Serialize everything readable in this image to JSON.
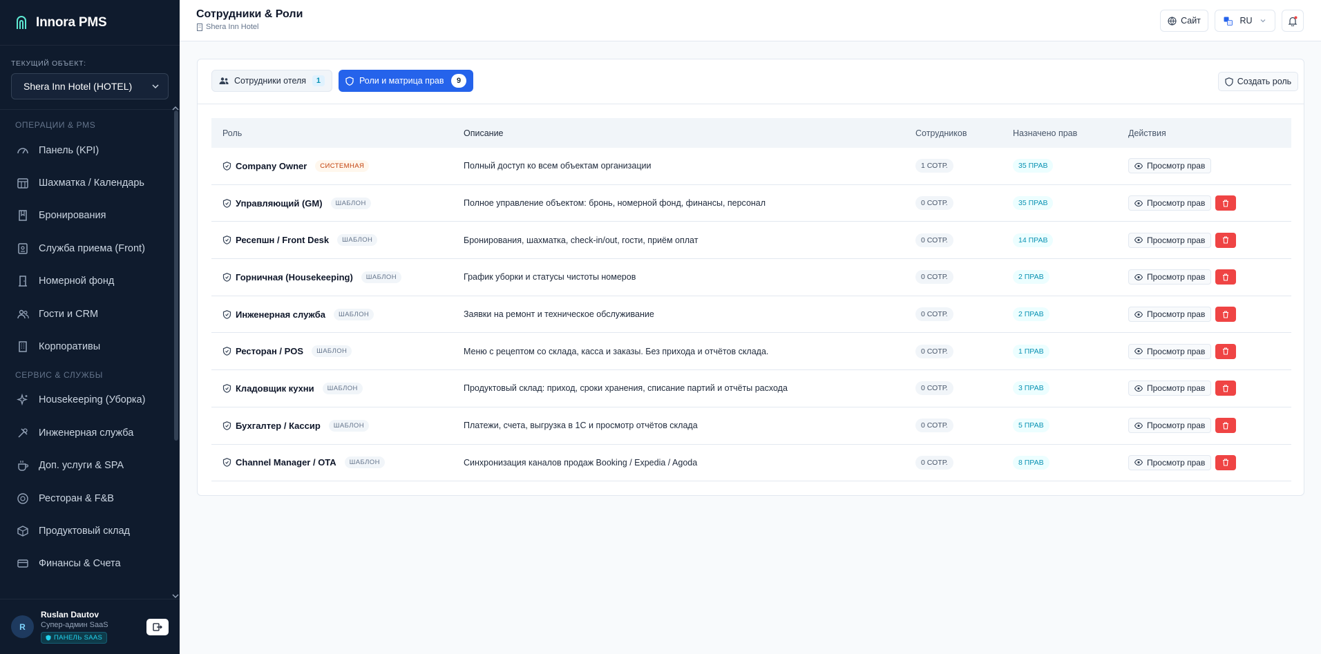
{
  "sidebar": {
    "brand": "Innora PMS",
    "object_label": "ТЕКУЩИЙ ОБЪЕКТ:",
    "object_value": "Shera Inn Hotel (HOTEL)",
    "sections": [
      {
        "title": "ОПЕРАЦИИ & PMS",
        "items": [
          {
            "label": "Панель (KPI)",
            "icon": "gauge-icon"
          },
          {
            "label": "Шахматка / Календарь",
            "icon": "calendar-grid-icon"
          },
          {
            "label": "Бронирования",
            "icon": "book-icon"
          },
          {
            "label": "Служба приема (Front)",
            "icon": "id-card-icon"
          },
          {
            "label": "Номерной фонд",
            "icon": "door-icon"
          },
          {
            "label": "Гости и CRM",
            "icon": "users-icon"
          },
          {
            "label": "Корпоративы",
            "icon": "building-icon"
          }
        ]
      },
      {
        "title": "СЕРВИС & СЛУЖБЫ",
        "items": [
          {
            "label": "Housekeeping (Уборка)",
            "icon": "sparkles-icon"
          },
          {
            "label": "Инженерная служба",
            "icon": "tools-icon"
          },
          {
            "label": "Доп. услуги & SPA",
            "icon": "cup-icon"
          },
          {
            "label": "Ресторан & F&B",
            "icon": "dish-icon"
          },
          {
            "label": "Продуктовый склад",
            "icon": "box-icon"
          },
          {
            "label": "Финансы & Счета",
            "icon": "credit-card-icon"
          }
        ]
      }
    ],
    "user": {
      "initial": "R",
      "name": "Ruslan Dautov",
      "role": "Супер-админ SaaS",
      "badge": "ПАНЕЛЬ SAAS"
    }
  },
  "header": {
    "title": "Сотрудники & Роли",
    "subtitle": "Shera Inn Hotel",
    "site_label": "Сайт",
    "lang": "RU"
  },
  "tabs": [
    {
      "label": "Сотрудники отеля",
      "count": "1"
    },
    {
      "label": "Роли и матрица прав",
      "count": "9"
    }
  ],
  "create_role_label": "Создать роль",
  "table": {
    "columns": [
      "Роль",
      "Описание",
      "Сотрудников",
      "Назначено прав",
      "Действия"
    ],
    "view_label": "Просмотр прав",
    "rows": [
      {
        "role": "Company Owner",
        "badge": "СИСТЕМНАЯ",
        "badge_type": "sys",
        "desc": "Полный доступ ко всем объектам организации",
        "emp": "1 СОТР.",
        "perms": "35 ПРАВ",
        "deletable": false
      },
      {
        "role": "Управляющий (GM)",
        "badge": "ШАБЛОН",
        "badge_type": "tpl",
        "desc": "Полное управление объектом: бронь, номерной фонд, финансы, персонал",
        "emp": "0 СОТР.",
        "perms": "35 ПРАВ",
        "deletable": true
      },
      {
        "role": "Ресепшн / Front Desk",
        "badge": "ШАБЛОН",
        "badge_type": "tpl",
        "desc": "Бронирования, шахматка, check-in/out, гости, приём оплат",
        "emp": "0 СОТР.",
        "perms": "14 ПРАВ",
        "deletable": true
      },
      {
        "role": "Горничная (Housekeeping)",
        "badge": "ШАБЛОН",
        "badge_type": "tpl",
        "desc": "График уборки и статусы чистоты номеров",
        "emp": "0 СОТР.",
        "perms": "2 ПРАВ",
        "deletable": true
      },
      {
        "role": "Инженерная служба",
        "badge": "ШАБЛОН",
        "badge_type": "tpl",
        "desc": "Заявки на ремонт и техническое обслуживание",
        "emp": "0 СОТР.",
        "perms": "2 ПРАВ",
        "deletable": true
      },
      {
        "role": "Ресторан / POS",
        "badge": "ШАБЛОН",
        "badge_type": "tpl",
        "desc": "Меню с рецептом со склада, касса и заказы. Без прихода и отчётов склада.",
        "emp": "0 СОТР.",
        "perms": "1 ПРАВ",
        "deletable": true
      },
      {
        "role": "Кладовщик кухни",
        "badge": "ШАБЛОН",
        "badge_type": "tpl",
        "desc": "Продуктовый склад: приход, сроки хранения, списание партий и отчёты расхода",
        "emp": "0 СОТР.",
        "perms": "3 ПРАВ",
        "deletable": true
      },
      {
        "role": "Бухгалтер / Кассир",
        "badge": "ШАБЛОН",
        "badge_type": "tpl",
        "desc": "Платежи, счета, выгрузка в 1С и просмотр отчётов склада",
        "emp": "0 СОТР.",
        "perms": "5 ПРАВ",
        "deletable": true
      },
      {
        "role": "Channel Manager / OTA",
        "badge": "ШАБЛОН",
        "badge_type": "tpl",
        "desc": "Синхронизация каналов продаж Booking / Expedia / Agoda",
        "emp": "0 СОТР.",
        "perms": "8 ПРАВ",
        "deletable": true
      }
    ]
  },
  "colors": {
    "sidebar_bg": "#0f1b2d",
    "accent": "#2563eb",
    "danger": "#ef4444",
    "cyan": "#0891b2",
    "system_badge": "#c2410c"
  }
}
